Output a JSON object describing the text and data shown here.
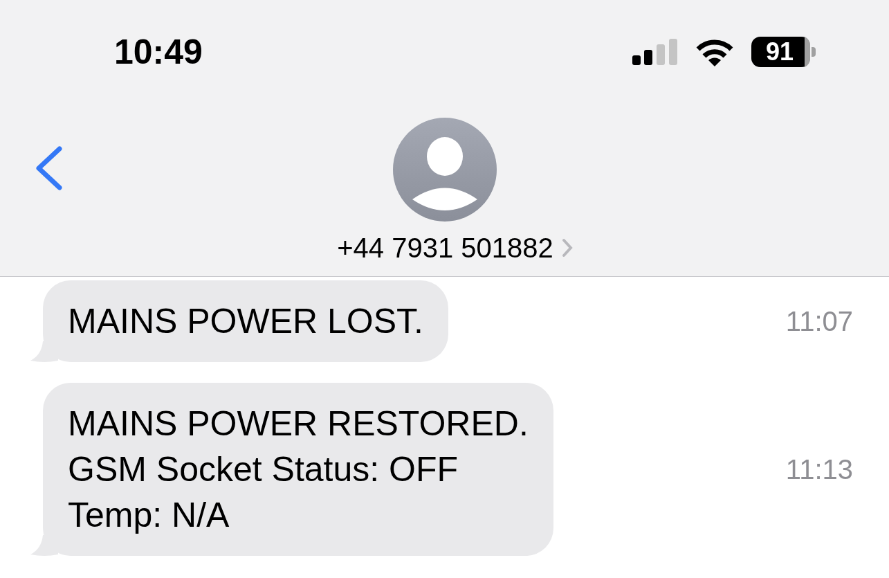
{
  "status_bar": {
    "time": "10:49",
    "battery": "91"
  },
  "header": {
    "contact": "+44 7931 501882"
  },
  "messages": [
    {
      "text": "MAINS POWER LOST.",
      "time": "11:07"
    },
    {
      "text": "MAINS POWER RESTORED.\nGSM Socket Status: OFF\nTemp: N/A",
      "time": "11:13"
    }
  ]
}
